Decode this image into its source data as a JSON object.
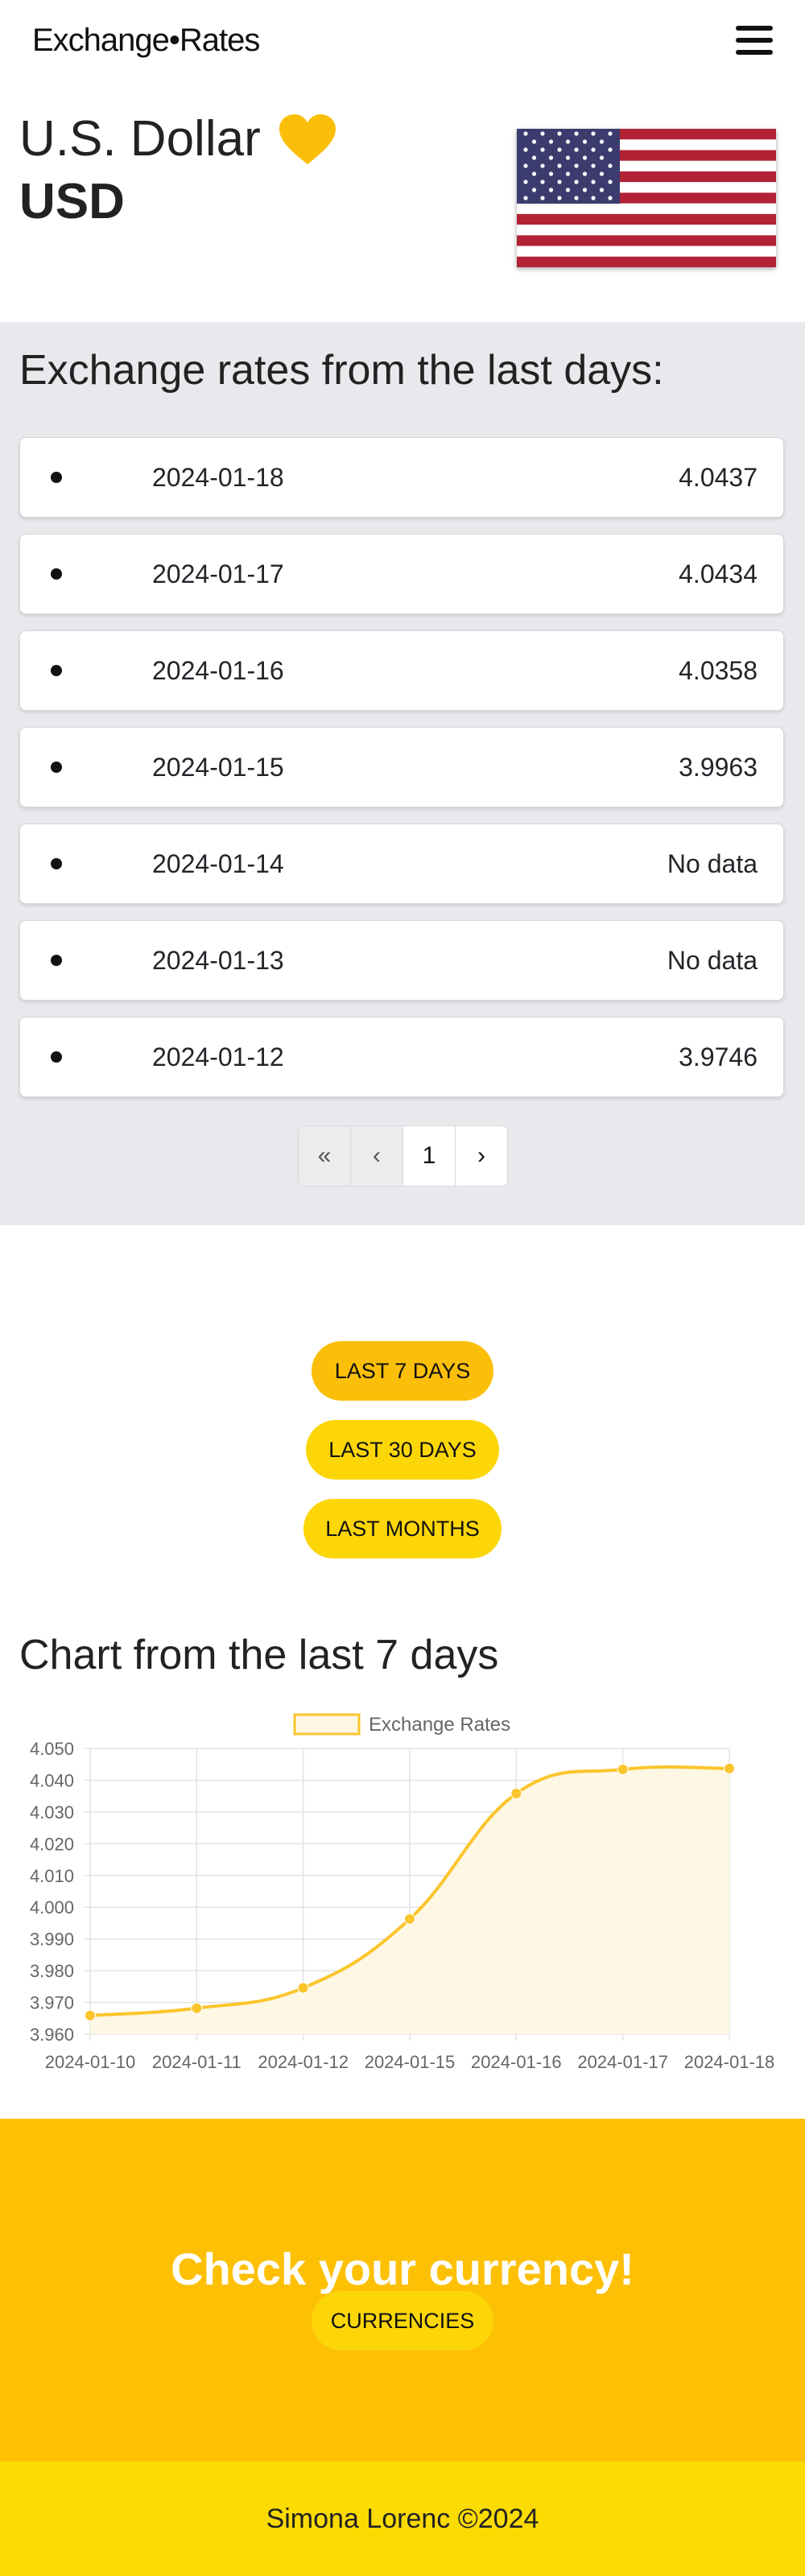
{
  "navbar": {
    "brand": "Exchange•Rates",
    "menu_icon": "hamburger-menu-icon"
  },
  "currency": {
    "name": "U.S. Dollar",
    "code": "USD",
    "favorite_icon": "heart-icon",
    "favorite_color": "#fbbf0a",
    "flag_icon": "us-flag-icon"
  },
  "rates": {
    "title": "Exchange rates from the last days:",
    "items": [
      {
        "date": "2024-01-18",
        "value": "4.0437"
      },
      {
        "date": "2024-01-17",
        "value": "4.0434"
      },
      {
        "date": "2024-01-16",
        "value": "4.0358"
      },
      {
        "date": "2024-01-15",
        "value": "3.9963"
      },
      {
        "date": "2024-01-14",
        "value": "No data"
      },
      {
        "date": "2024-01-13",
        "value": "No data"
      },
      {
        "date": "2024-01-12",
        "value": "3.9746"
      }
    ]
  },
  "pagination": {
    "first": "«",
    "prev": "‹",
    "current": "1",
    "next": "›"
  },
  "range_buttons": {
    "last7": "LAST 7 DAYS",
    "last30": "LAST 30 DAYS",
    "last_months": "LAST MONTHS"
  },
  "chart": {
    "title": "Chart from the last 7 days"
  },
  "chart_data": {
    "type": "line",
    "categories": [
      "2024-01-10",
      "2024-01-11",
      "2024-01-12",
      "2024-01-15",
      "2024-01-16",
      "2024-01-17",
      "2024-01-18"
    ],
    "series": [
      {
        "name": "Exchange Rates",
        "values": [
          3.9659,
          3.9682,
          3.9746,
          3.9963,
          4.0358,
          4.0434,
          4.0437
        ]
      }
    ],
    "xlabel": "",
    "ylabel": "",
    "ylim": [
      3.96,
      4.05
    ],
    "yticks": [
      "4.050",
      "4.040",
      "4.030",
      "4.020",
      "4.010",
      "4.000",
      "3.990",
      "3.980",
      "3.970",
      "3.960"
    ],
    "grid": true,
    "legend": "top-center",
    "line_color": "#fbc52c",
    "fill_color": "#fdf7e4"
  },
  "cta": {
    "title": "Check your currency!",
    "button": "CURRENCIES"
  },
  "footer": {
    "text": "Simona Lorenc ©2024"
  },
  "colors": {
    "accent": "#fdc005",
    "secondary": "#fcd607",
    "section_bg": "#e8e9ec"
  }
}
